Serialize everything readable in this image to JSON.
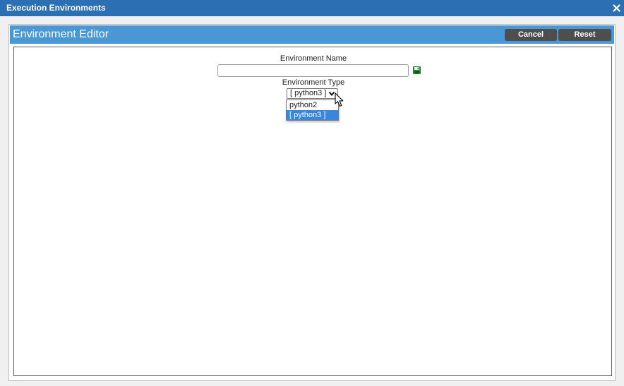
{
  "window": {
    "title": "Execution Environments",
    "close_glyph": "✕"
  },
  "editor": {
    "title": "Environment Editor",
    "cancel_label": "Cancel",
    "reset_label": "Reset"
  },
  "form": {
    "name_label": "Environment Name",
    "name_value": "",
    "type_label": "Environment Type",
    "type_selected": "[ python3 ]",
    "type_options": [
      "python2",
      "[ python3 ]"
    ],
    "type_highlighted_index": 1
  },
  "icons": {
    "save": "floppy-disk-icon",
    "close": "close-icon",
    "dropdown": "chevron-down-icon",
    "cursor": "mouse-pointer-icon"
  },
  "colors": {
    "titlebar": "#2d6fb3",
    "editor_header": "#4a97d6",
    "button": "#4e4e4e",
    "option_highlight": "#3a85dd",
    "save_icon": "#1e8a2e"
  }
}
